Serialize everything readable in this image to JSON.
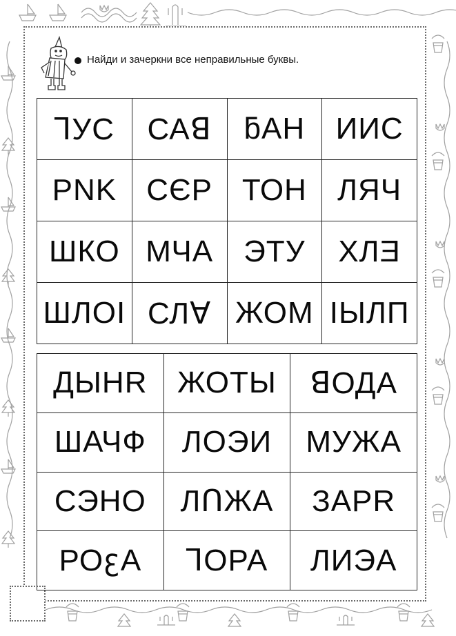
{
  "instruction": {
    "text": "Найди и зачеркни все неправильные буквы."
  },
  "icons": {
    "mascot": "pencil-character-icon",
    "bullet": "bullet-icon",
    "border": "decorative-border-pattern"
  },
  "colors": {
    "text": "#0a0a0a",
    "grid_lines": "#222222",
    "border_art": "#9a9a9a",
    "frame_dots": "#6a6a6a"
  },
  "grid_top": {
    "rows": [
      [
        "ꓶУС",
        "САꓭ",
        "ƃАН",
        "ИИС"
      ],
      [
        "PNK",
        "СЄР",
        "ТОН",
        "ЛЯЧ"
      ],
      [
        "ШКО",
        "МЧА",
        "ЭТУ",
        "ХЛƎ"
      ],
      [
        "ШЛОI",
        "СЛꓯ",
        "ЖОМ",
        "IЫЛП"
      ]
    ]
  },
  "grid_bottom": {
    "rows": [
      [
        "ДЫНR",
        "ЖОТЫ",
        "ꓭОДА"
      ],
      [
        "ШАЧФ",
        "ЛОЭИ",
        "МУЖА"
      ],
      [
        "СЭНО",
        "ЛꓵЖА",
        "ЗАPR"
      ],
      [
        "РОꜫА",
        "ꓶОРА",
        "ЛИЭА"
      ]
    ]
  }
}
